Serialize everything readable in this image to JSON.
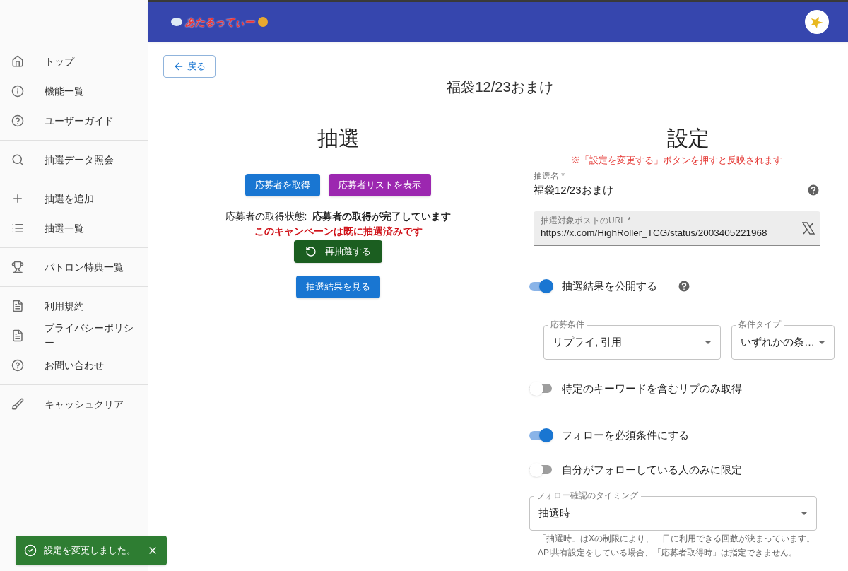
{
  "header": {
    "logo_text": "あたるってぃー"
  },
  "sidebar": {
    "groups": [
      {
        "items": [
          {
            "label": "トップ"
          },
          {
            "label": "機能一覧"
          },
          {
            "label": "ユーザーガイド"
          }
        ]
      },
      {
        "items": [
          {
            "label": "抽選データ照会"
          }
        ]
      },
      {
        "items": [
          {
            "label": "抽選を追加"
          },
          {
            "label": "抽選一覧"
          }
        ]
      },
      {
        "items": [
          {
            "label": "パトロン特典一覧"
          }
        ]
      },
      {
        "items": [
          {
            "label": "利用規約"
          },
          {
            "label": "プライバシーポリシー"
          },
          {
            "label": "お問い合わせ"
          }
        ]
      },
      {
        "items": [
          {
            "label": "キャッシュクリア"
          }
        ]
      }
    ]
  },
  "back_button": "戻る",
  "page_title": "福袋12/23おまけ",
  "lottery": {
    "heading": "抽選",
    "buttons": [
      {
        "label": "応募者を取得",
        "color": "#1976d2"
      },
      {
        "label": "応募者リストを表示",
        "color": "#9c27b0"
      }
    ],
    "status_label": "応募者の取得状態:",
    "status_value": "応募者の取得が完了しています",
    "warning": "このキャンペーンは既に抽選済みです",
    "redraw_button": "再抽選する",
    "results_button": "抽選結果を見る"
  },
  "settings": {
    "heading": "設定",
    "note": "※「設定を変更する」ボタンを押すと反映されます",
    "name_field": {
      "label": "抽選名 *",
      "value": "福袋12/23おまけ"
    },
    "url_field": {
      "label": "抽選対象ポストのURL *",
      "value": "https://x.com/HighRoller_TCG/status/2003405221968"
    },
    "controls": [
      {
        "kind": "toggle",
        "label": "抽選結果を公開する",
        "on": true,
        "help": true
      },
      {
        "kind": "selects",
        "selects": [
          {
            "label": "応募条件",
            "value": "リプライ, 引用"
          },
          {
            "label": "条件タイプ",
            "value": "いずれかの条…"
          }
        ]
      },
      {
        "kind": "toggle",
        "label": "特定のキーワードを含むリプのみ取得",
        "on": false,
        "help": false
      },
      {
        "kind": "toggle",
        "label": "フォローを必須条件にする",
        "on": true,
        "help": false
      },
      {
        "kind": "toggle",
        "label": "自分がフォローしている人のみに限定",
        "on": false,
        "help": false
      },
      {
        "kind": "select",
        "label": "フォロー確認のタイミング",
        "value": "抽選時",
        "helper": [
          "「抽選時」はXの制限により、一日に利用できる回数が決まっています。",
          "API共有設定をしている場合、「応募者取得時」は指定できません。"
        ]
      }
    ]
  },
  "toast": {
    "message": "設定を変更しました。"
  }
}
